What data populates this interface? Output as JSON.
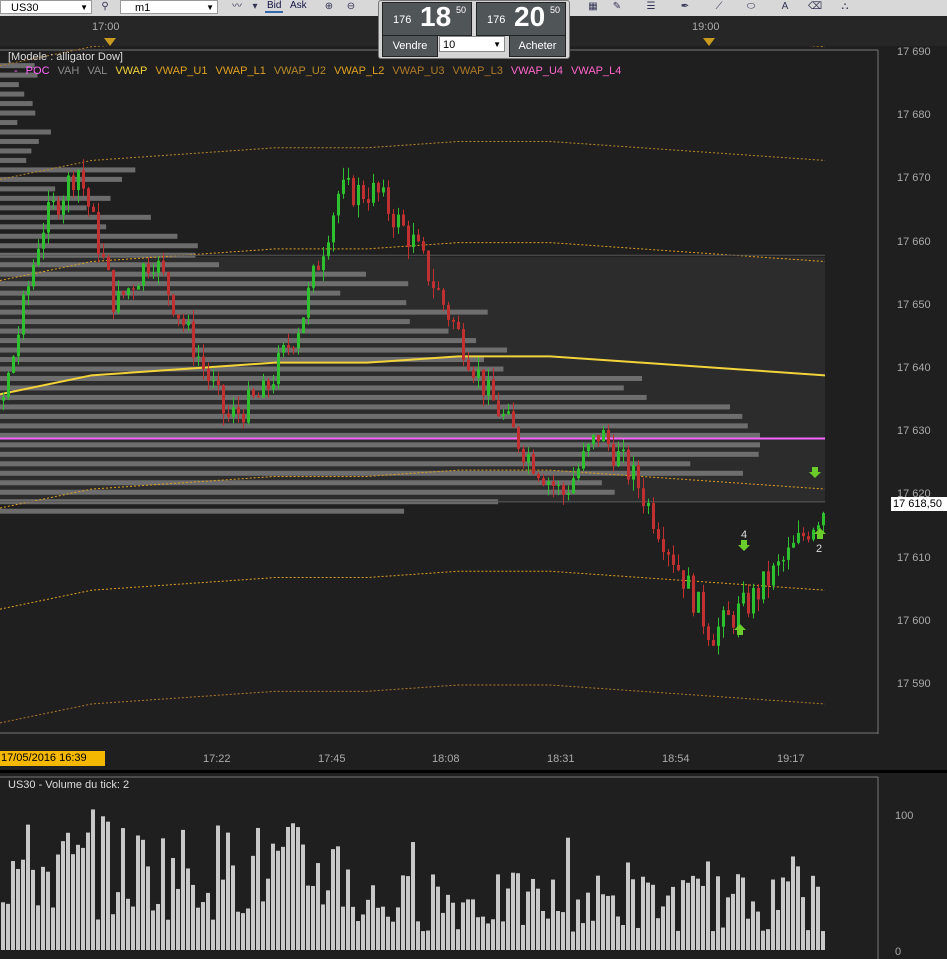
{
  "toolbar": {
    "symbol": "US30",
    "timeframe": "m1",
    "bid_label": "Bid",
    "ask_label": "Ask"
  },
  "order_panel": {
    "sell": {
      "small": "176",
      "big": "18",
      "sup": "50",
      "label": "Vendre"
    },
    "buy": {
      "small": "176",
      "big": "20",
      "sup": "50",
      "label": "Acheter"
    },
    "quantity": "10"
  },
  "time_header": {
    "labels": [
      "17:00",
      "19:00"
    ]
  },
  "legend": {
    "title": "[Modele : alligator Dow]",
    "items": [
      {
        "label": "-",
        "color": "#ff66ff"
      },
      {
        "label": "POC",
        "color": "#ff66ff"
      },
      {
        "label": "VAH",
        "color": "#8a8a8a"
      },
      {
        "label": "VAL",
        "color": "#8a8a8a"
      },
      {
        "label": "VWAP",
        "color": "#f2d33a"
      },
      {
        "label": "VWAP_U1",
        "color": "#e0a020"
      },
      {
        "label": "VWAP_L1",
        "color": "#e0a020"
      },
      {
        "label": "VWAP_U2",
        "color": "#b88a28"
      },
      {
        "label": "VWAP_L2",
        "color": "#e0a020"
      },
      {
        "label": "VWAP_U3",
        "color": "#b07a28"
      },
      {
        "label": "VWAP_L3",
        "color": "#b07a28"
      },
      {
        "label": "VWAP_U4",
        "color": "#ff66cc"
      },
      {
        "label": "VWAP_L4",
        "color": "#ff66cc"
      }
    ]
  },
  "price_axis": {
    "ticks": [
      "17 690",
      "17 680",
      "17 670",
      "17 660",
      "17 650",
      "17 640",
      "17 630",
      "17 620",
      "17 610",
      "17 600",
      "17 590"
    ],
    "last_price": "17 618,50"
  },
  "time_axis": {
    "date_label": "17/05/2016 16:39",
    "ticks": [
      "17:22",
      "17:45",
      "18:08",
      "18:31",
      "18:54",
      "19:17"
    ]
  },
  "signals": {
    "down_count": "4",
    "up_count": "2"
  },
  "volume_panel": {
    "title": "US30 - Volume du tick: 2",
    "ticks": [
      "100",
      "0"
    ]
  },
  "colors": {
    "up_candle": "#2fc02f",
    "down_candle": "#c03030",
    "vwap": "#f2d33a",
    "poc": "#ff66ff",
    "background": "#1f1f1f"
  },
  "chart_data": {
    "type": "candlestick",
    "ylim": [
      17583,
      17692
    ],
    "poc": 17629,
    "value_area_high": 17658,
    "value_area_low": 17619,
    "last": 17618.5,
    "vwap": [
      17636,
      17639,
      17640,
      17641,
      17641,
      17642,
      17642,
      17641,
      17640,
      17639
    ],
    "close_path": [
      17635,
      17662,
      17672,
      17650,
      17658,
      17645,
      17632,
      17636,
      17648,
      17668,
      17668,
      17660,
      17648,
      17636,
      17627,
      17620,
      17630,
      17622,
      17610,
      17598,
      17603,
      17610,
      17618
    ]
  }
}
